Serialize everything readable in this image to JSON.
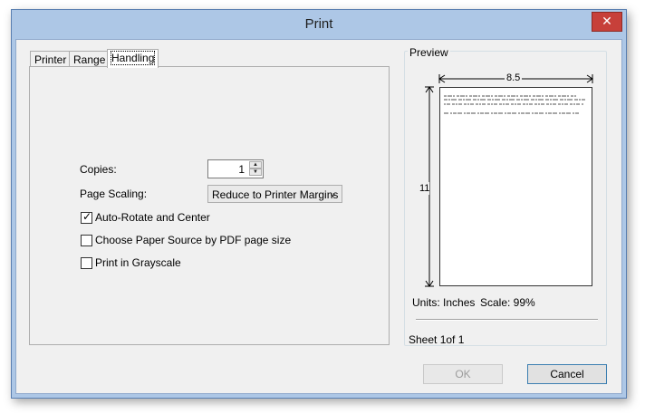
{
  "window": {
    "title": "Print",
    "close_glyph": "✕"
  },
  "tabs": [
    {
      "label": "Printer",
      "active": false
    },
    {
      "label": "Range",
      "active": false
    },
    {
      "label": "Handling",
      "active": true
    }
  ],
  "handling": {
    "copies_label": "Copies:",
    "copies_value": "1",
    "scaling_label": "Page Scaling:",
    "scaling_value": "Reduce to Printer Margins",
    "options": [
      {
        "label": "Auto-Rotate and Center",
        "checked": true
      },
      {
        "label": "Choose Paper Source by PDF page size",
        "checked": false
      },
      {
        "label": "Print in Grayscale",
        "checked": false
      }
    ]
  },
  "preview": {
    "title": "Preview",
    "width_dim": "8.5",
    "height_dim": "11",
    "units": "Units: Inches",
    "scale": "Scale: 99%",
    "sheet": "Sheet 1of 1"
  },
  "buttons": {
    "ok": "OK",
    "cancel": "Cancel"
  },
  "icons": {
    "close": "close-icon",
    "spin_up": "chevron-up-icon",
    "spin_down": "chevron-down-icon",
    "dropdown": "chevron-down-icon"
  }
}
